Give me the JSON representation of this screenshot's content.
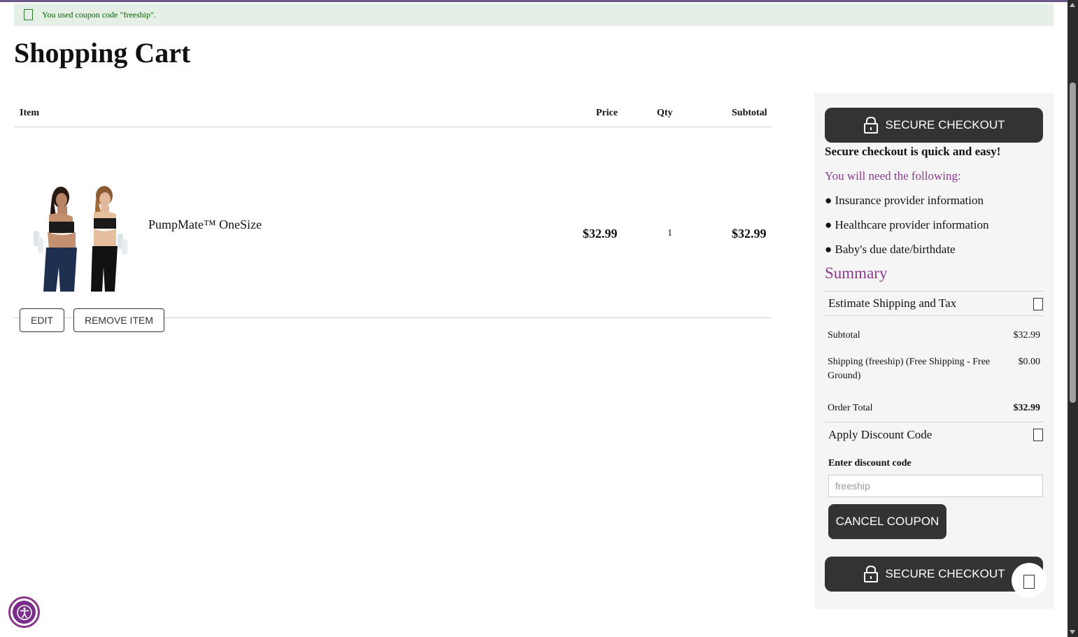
{
  "notice": {
    "message": "You used coupon code \"freeship\"."
  },
  "page": {
    "title": "Shopping Cart"
  },
  "cart": {
    "headers": {
      "item": "Item",
      "price": "Price",
      "qty": "Qty",
      "subtotal": "Subtotal"
    },
    "items": [
      {
        "name": "PumpMate™ OneSize",
        "price": "$32.99",
        "qty": "1",
        "subtotal": "$32.99"
      }
    ],
    "edit_label": "EDIT",
    "remove_label": "REMOVE ITEM"
  },
  "sidebar": {
    "checkout_label": "SECURE CHECKOUT",
    "quick_easy": "Secure checkout is quick and easy!",
    "need_following": "You will need the following:",
    "requirements": [
      "● Insurance provider information",
      "● Healthcare provider information",
      "● Baby's due date/birthdate"
    ],
    "summary_title": "Summary",
    "estimate_label": "Estimate Shipping and Tax",
    "totals": {
      "subtotal_label": "Subtotal",
      "subtotal_value": "$32.99",
      "shipping_label": "Shipping (freeship) (Free Shipping - Free Ground)",
      "shipping_value": "$0.00",
      "order_total_label": "Order Total",
      "order_total_value": "$32.99"
    },
    "discount": {
      "toggle_label": "Apply Discount Code",
      "field_label": "Enter discount code",
      "placeholder": "freeship",
      "cancel_label": "CANCEL COUPON"
    }
  },
  "icons": {
    "lock": "lock-icon",
    "accessibility": "accessibility-icon",
    "notice": "checkbox-icon"
  },
  "colors": {
    "accent_purple": "#8a3a8a",
    "button_dark": "#333333",
    "notice_bg": "#e5efe5",
    "notice_text": "#006400"
  }
}
